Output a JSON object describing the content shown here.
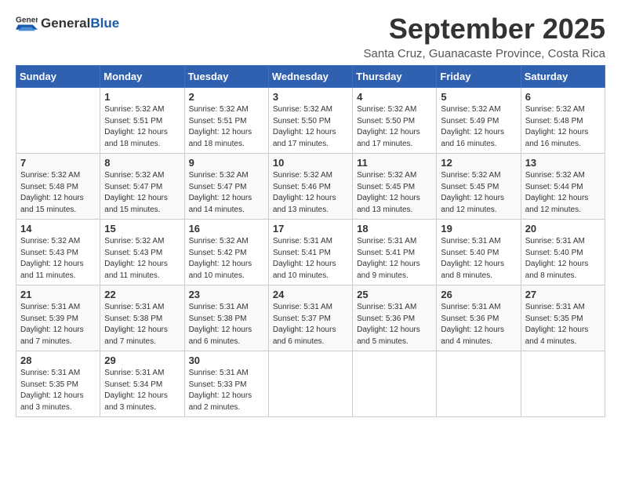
{
  "logo": {
    "general": "General",
    "blue": "Blue"
  },
  "title": "September 2025",
  "subtitle": "Santa Cruz, Guanacaste Province, Costa Rica",
  "weekdays": [
    "Sunday",
    "Monday",
    "Tuesday",
    "Wednesday",
    "Thursday",
    "Friday",
    "Saturday"
  ],
  "weeks": [
    [
      {
        "day": "",
        "content": ""
      },
      {
        "day": "1",
        "content": "Sunrise: 5:32 AM\nSunset: 5:51 PM\nDaylight: 12 hours\nand 18 minutes."
      },
      {
        "day": "2",
        "content": "Sunrise: 5:32 AM\nSunset: 5:51 PM\nDaylight: 12 hours\nand 18 minutes."
      },
      {
        "day": "3",
        "content": "Sunrise: 5:32 AM\nSunset: 5:50 PM\nDaylight: 12 hours\nand 17 minutes."
      },
      {
        "day": "4",
        "content": "Sunrise: 5:32 AM\nSunset: 5:50 PM\nDaylight: 12 hours\nand 17 minutes."
      },
      {
        "day": "5",
        "content": "Sunrise: 5:32 AM\nSunset: 5:49 PM\nDaylight: 12 hours\nand 16 minutes."
      },
      {
        "day": "6",
        "content": "Sunrise: 5:32 AM\nSunset: 5:48 PM\nDaylight: 12 hours\nand 16 minutes."
      }
    ],
    [
      {
        "day": "7",
        "content": "Sunrise: 5:32 AM\nSunset: 5:48 PM\nDaylight: 12 hours\nand 15 minutes."
      },
      {
        "day": "8",
        "content": "Sunrise: 5:32 AM\nSunset: 5:47 PM\nDaylight: 12 hours\nand 15 minutes."
      },
      {
        "day": "9",
        "content": "Sunrise: 5:32 AM\nSunset: 5:47 PM\nDaylight: 12 hours\nand 14 minutes."
      },
      {
        "day": "10",
        "content": "Sunrise: 5:32 AM\nSunset: 5:46 PM\nDaylight: 12 hours\nand 13 minutes."
      },
      {
        "day": "11",
        "content": "Sunrise: 5:32 AM\nSunset: 5:45 PM\nDaylight: 12 hours\nand 13 minutes."
      },
      {
        "day": "12",
        "content": "Sunrise: 5:32 AM\nSunset: 5:45 PM\nDaylight: 12 hours\nand 12 minutes."
      },
      {
        "day": "13",
        "content": "Sunrise: 5:32 AM\nSunset: 5:44 PM\nDaylight: 12 hours\nand 12 minutes."
      }
    ],
    [
      {
        "day": "14",
        "content": "Sunrise: 5:32 AM\nSunset: 5:43 PM\nDaylight: 12 hours\nand 11 minutes."
      },
      {
        "day": "15",
        "content": "Sunrise: 5:32 AM\nSunset: 5:43 PM\nDaylight: 12 hours\nand 11 minutes."
      },
      {
        "day": "16",
        "content": "Sunrise: 5:32 AM\nSunset: 5:42 PM\nDaylight: 12 hours\nand 10 minutes."
      },
      {
        "day": "17",
        "content": "Sunrise: 5:31 AM\nSunset: 5:41 PM\nDaylight: 12 hours\nand 10 minutes."
      },
      {
        "day": "18",
        "content": "Sunrise: 5:31 AM\nSunset: 5:41 PM\nDaylight: 12 hours\nand 9 minutes."
      },
      {
        "day": "19",
        "content": "Sunrise: 5:31 AM\nSunset: 5:40 PM\nDaylight: 12 hours\nand 8 minutes."
      },
      {
        "day": "20",
        "content": "Sunrise: 5:31 AM\nSunset: 5:40 PM\nDaylight: 12 hours\nand 8 minutes."
      }
    ],
    [
      {
        "day": "21",
        "content": "Sunrise: 5:31 AM\nSunset: 5:39 PM\nDaylight: 12 hours\nand 7 minutes."
      },
      {
        "day": "22",
        "content": "Sunrise: 5:31 AM\nSunset: 5:38 PM\nDaylight: 12 hours\nand 7 minutes."
      },
      {
        "day": "23",
        "content": "Sunrise: 5:31 AM\nSunset: 5:38 PM\nDaylight: 12 hours\nand 6 minutes."
      },
      {
        "day": "24",
        "content": "Sunrise: 5:31 AM\nSunset: 5:37 PM\nDaylight: 12 hours\nand 6 minutes."
      },
      {
        "day": "25",
        "content": "Sunrise: 5:31 AM\nSunset: 5:36 PM\nDaylight: 12 hours\nand 5 minutes."
      },
      {
        "day": "26",
        "content": "Sunrise: 5:31 AM\nSunset: 5:36 PM\nDaylight: 12 hours\nand 4 minutes."
      },
      {
        "day": "27",
        "content": "Sunrise: 5:31 AM\nSunset: 5:35 PM\nDaylight: 12 hours\nand 4 minutes."
      }
    ],
    [
      {
        "day": "28",
        "content": "Sunrise: 5:31 AM\nSunset: 5:35 PM\nDaylight: 12 hours\nand 3 minutes."
      },
      {
        "day": "29",
        "content": "Sunrise: 5:31 AM\nSunset: 5:34 PM\nDaylight: 12 hours\nand 3 minutes."
      },
      {
        "day": "30",
        "content": "Sunrise: 5:31 AM\nSunset: 5:33 PM\nDaylight: 12 hours\nand 2 minutes."
      },
      {
        "day": "",
        "content": ""
      },
      {
        "day": "",
        "content": ""
      },
      {
        "day": "",
        "content": ""
      },
      {
        "day": "",
        "content": ""
      }
    ]
  ]
}
